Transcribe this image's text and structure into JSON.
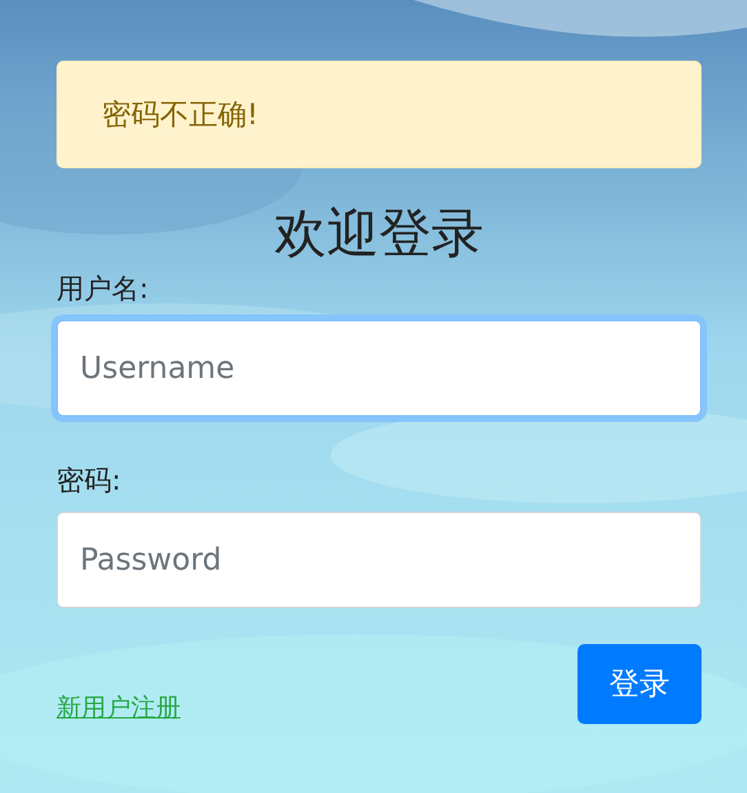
{
  "alert": {
    "text": "密码不正确!"
  },
  "title": "欢迎登录",
  "fields": [
    {
      "label": "用户名:",
      "placeholder": "Username",
      "focused": true
    },
    {
      "label": "密码:",
      "placeholder": "Password",
      "focused": false
    }
  ],
  "register_link": "新用户注册",
  "login_button": "登录"
}
